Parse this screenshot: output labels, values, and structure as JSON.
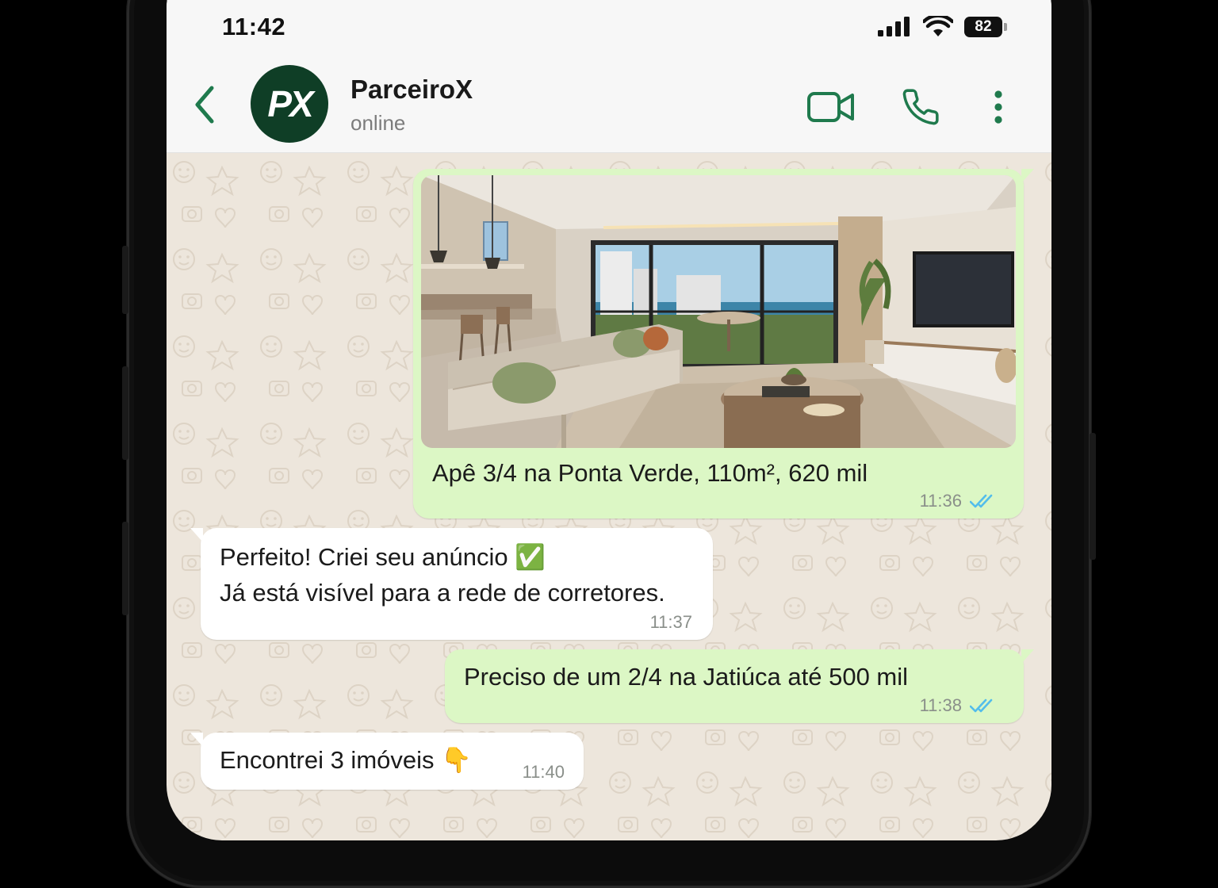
{
  "status_bar": {
    "time": "11:42",
    "battery": "82"
  },
  "header": {
    "contact_name": "ParceiroX",
    "contact_status": "online",
    "avatar_initials": "PX",
    "accent_color": "#1f7a4d"
  },
  "messages": [
    {
      "id": "m1",
      "direction": "outgoing",
      "has_image": true,
      "image_subject": "living-room-with-balcony-photo",
      "text": "Apê 3/4 na Ponta Verde, 110m², 620 mil",
      "time": "11:36",
      "read": true
    },
    {
      "id": "m2",
      "direction": "incoming",
      "line1": "Perfeito! Criei seu anúncio ✅",
      "line2": "Já está visível para a rede de corretores.",
      "time": "11:37"
    },
    {
      "id": "m3",
      "direction": "outgoing",
      "text": "Preciso de um 2/4 na Jatiúca até 500 mil",
      "time": "11:38",
      "read": true
    },
    {
      "id": "m4",
      "direction": "incoming",
      "text": "Encontrei 3 imóveis 👇",
      "time": "11:40"
    }
  ],
  "icons": {
    "back": "chevron-left-icon",
    "video": "video-camera-icon",
    "call": "phone-icon",
    "menu": "more-vertical-icon",
    "read_receipt": "double-check-icon"
  },
  "colors": {
    "outgoing_bubble": "#dcf7c5",
    "incoming_bubble": "#ffffff",
    "chat_background": "#ede6dc",
    "read_tick": "#53bdeb"
  }
}
